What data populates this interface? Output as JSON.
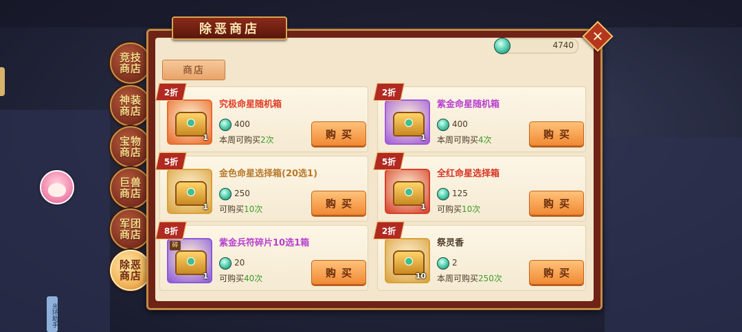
{
  "title": "除恶商店",
  "currency": {
    "amount": "4740",
    "icon": "jade-gem-icon"
  },
  "shop_tab": "商店",
  "side_tabs": [
    {
      "label": "竞技商店",
      "active": false
    },
    {
      "label": "神装商店",
      "active": false
    },
    {
      "label": "宝物商店",
      "active": false
    },
    {
      "label": "巨兽商店",
      "active": false
    },
    {
      "label": "军团商店",
      "active": false
    },
    {
      "label": "除恶商店",
      "active": true
    }
  ],
  "helper_label": "光环助手",
  "buy_label": "购买",
  "items": [
    {
      "discount": "2折",
      "name": "究极命星随机箱",
      "name_color": "#e0402a",
      "price": "400",
      "limit_prefix": "本周可购买",
      "limit_count": "2次",
      "count": "1",
      "frame": "#e86a2a"
    },
    {
      "discount": "2折",
      "name": "紫金命星随机箱",
      "name_color": "#b63fd0",
      "price": "400",
      "limit_prefix": "本周可购买",
      "limit_count": "4次",
      "count": "1",
      "frame": "#a05ad8"
    },
    {
      "discount": "5折",
      "name": "金色命星选择箱(20选1)",
      "name_color": "#b8782a",
      "price": "250",
      "limit_prefix": "可购买",
      "limit_count": "10次",
      "count": "1",
      "frame": "#d9a03a"
    },
    {
      "discount": "5折",
      "name": "全红命星选择箱",
      "name_color": "#d63422",
      "price": "125",
      "limit_prefix": "可购买",
      "limit_count": "10次",
      "count": "1",
      "frame": "#d6402a"
    },
    {
      "discount": "8折",
      "name": "紫金兵符碎片10选1箱",
      "name_color": "#b63fd0",
      "price": "20",
      "limit_prefix": "可购买",
      "limit_count": "40次",
      "count": "1",
      "frame": "#8a5ad8",
      "badge": "碎"
    },
    {
      "discount": "2折",
      "name": "祭灵香",
      "name_color": "#4a3a25",
      "price": "2",
      "limit_prefix": "本周可购买",
      "limit_count": "250次",
      "count": "10",
      "frame": "#d9a03a"
    }
  ]
}
